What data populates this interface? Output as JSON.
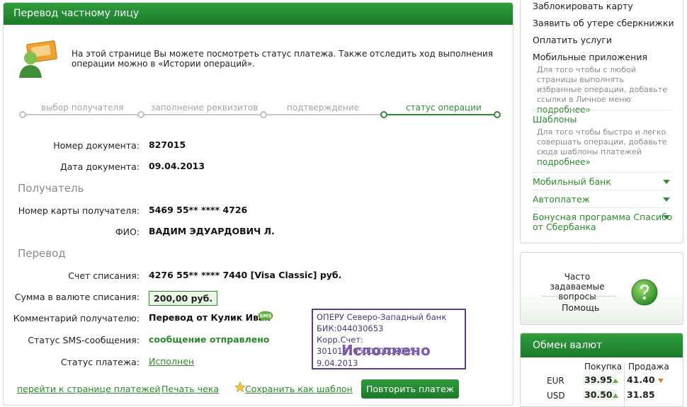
{
  "header": {
    "title": "Перевод частному лицу"
  },
  "intro": {
    "text": "На этой странице Вы можете посмотреть статус платежа. Также отследить ход выполнения операции можно в «Истории операций»."
  },
  "steps": [
    {
      "label": "выбор получателя",
      "active": false
    },
    {
      "label": "заполнение реквизитов",
      "active": false
    },
    {
      "label": "подтверждение",
      "active": false
    },
    {
      "label": "статус операции",
      "active": true
    }
  ],
  "document": {
    "number_label": "Номер документа:",
    "number": "827015",
    "date_label": "Дата документа:",
    "date": "09.04.2013"
  },
  "recipient": {
    "section_title": "Получатель",
    "card_label": "Номер карты получателя:",
    "card": "5469 55** **** 4726",
    "name_label": "ФИО:",
    "name": "ВАДИМ ЭДУАРДОВИЧ Л."
  },
  "transfer": {
    "section_title": "Перевод",
    "account_label": "Счет списания:",
    "account": "4276 55** **** 7440  [Visa Classic]  руб.",
    "amount_label": "Сумма в валюте списания:",
    "amount": "200,00  руб.",
    "comment_label": "Комментарий получателю:",
    "comment": "Перевод от Кулик Иван",
    "sms_badge": "SMS",
    "sms_status_label": "Статус SMS-сообщения:",
    "sms_status": "сообщение отправлено",
    "payment_status_label": "Статус платежа:",
    "payment_status": "Исполнен"
  },
  "stamp": {
    "line1": "ОПЕРУ Северо-Западный банк",
    "line2": "БИК:044030653",
    "line3": "Корр.Счет: 30101810500000000653",
    "status": "Исполнено",
    "date": "9.04.2013"
  },
  "actions": {
    "payments_link": "перейти к странице платежей",
    "print_link": "Печать чека",
    "template_link": "Сохранить как шаблон",
    "repeat_button": "Повторить платеж"
  },
  "sidebar": {
    "block_card": "Заблокировать карту",
    "lost_book": "Заявить об утере сберкнижки",
    "pay_services": "Оплатить услуги",
    "mobile_apps": "Мобильные приложения",
    "mobile_apps_desc": "Для того чтобы с любой страницы выполнять избранные операции, добавьте ссылки в Личное меню",
    "more": "подробнее»",
    "templates": "Шаблоны",
    "templates_desc": "Для того чтобы быстро и легко совершать операции, добавьте сюда шаблоны платежей",
    "mobile_bank": "Мобильный банк",
    "autopay": "Автоплатеж",
    "bonus_line1": "Бонусная программа Спасибо",
    "bonus_line2": "от Сбербанка"
  },
  "faq": {
    "title": "Часто задаваемые вопросы",
    "help": "Помощь"
  },
  "exchange": {
    "title": "Обмен валют",
    "buy_header": "Покупка",
    "sell_header": "Продажа",
    "rows": [
      {
        "currency": "EUR",
        "buy": "39.95",
        "buy_trend": "up",
        "sell": "41.40",
        "sell_trend": "down"
      },
      {
        "currency": "USD",
        "buy": "30.50",
        "buy_trend": "up",
        "sell": "31.85",
        "sell_trend": "none"
      }
    ]
  },
  "colors": {
    "brand_green": "#2d8d3a",
    "stamp_purple": "#5b3f82",
    "muted": "#8a8a8a"
  }
}
